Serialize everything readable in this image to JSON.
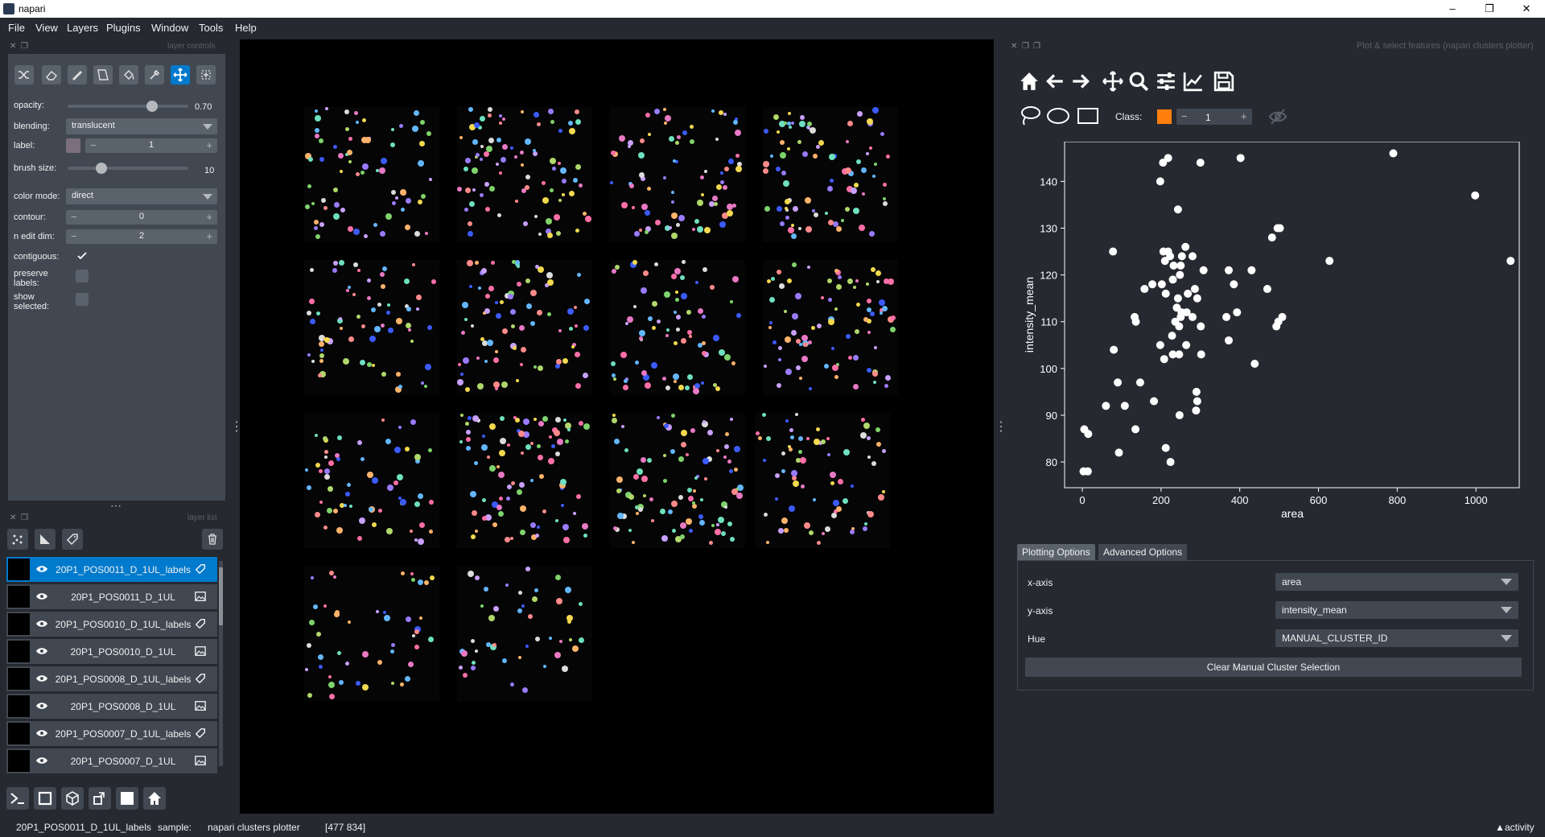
{
  "window": {
    "title": "napari"
  },
  "menu": [
    "File",
    "View",
    "Layers",
    "Plugins",
    "Window",
    "Tools",
    "Help"
  ],
  "layer_controls": {
    "header": "layer controls",
    "opacity_label": "opacity:",
    "opacity_value": "0.70",
    "blending_label": "blending:",
    "blending_value": "translucent",
    "label_label": "label:",
    "label_value": "1",
    "brush_label": "brush size:",
    "brush_value": "10",
    "colormode_label": "color mode:",
    "colormode_value": "direct",
    "contour_label": "contour:",
    "contour_value": "0",
    "ndim_label": "n edit dim:",
    "ndim_value": "2",
    "contiguous_label": "contiguous:",
    "preserve_label": "preserve labels:",
    "show_label": "show selected:",
    "label_color": "#7b6f7f",
    "opacity_fraction": 0.7,
    "brush_fraction": 0.28
  },
  "layer_list": {
    "header": "layer list",
    "layers": [
      {
        "name": "20P1_POS0011_D_1UL_labels",
        "type": "labels",
        "selected": true
      },
      {
        "name": "20P1_POS0011_D_1UL",
        "type": "image",
        "selected": false
      },
      {
        "name": "20P1_POS0010_D_1UL_labels",
        "type": "labels",
        "selected": false
      },
      {
        "name": "20P1_POS0010_D_1UL",
        "type": "image",
        "selected": false
      },
      {
        "name": "20P1_POS0008_D_1UL_labels",
        "type": "labels",
        "selected": false
      },
      {
        "name": "20P1_POS0008_D_1UL",
        "type": "image",
        "selected": false
      },
      {
        "name": "20P1_POS0007_D_1UL_labels",
        "type": "labels",
        "selected": false
      },
      {
        "name": "20P1_POS0007_D_1UL",
        "type": "image",
        "selected": false
      }
    ]
  },
  "plotter": {
    "header": "Plot & select features (napari clusters plotter)",
    "class_label": "Class:",
    "class_value": "1",
    "class_color": "#ff7f0e",
    "tabs": [
      "Plotting Options",
      "Advanced Options"
    ],
    "x_axis_label": "x-axis",
    "x_axis_value": "area",
    "y_axis_label": "y-axis",
    "y_axis_value": "intensity_mean",
    "hue_label": "Hue",
    "hue_value": "MANUAL_CLUSTER_ID",
    "clear_button": "Clear Manual Cluster Selection"
  },
  "chart_data": {
    "type": "scatter",
    "xlabel": "area",
    "ylabel": "intensity_mean",
    "xlim": [
      -45,
      1110
    ],
    "ylim": [
      74.5,
      148.5
    ],
    "xticks": [
      "0",
      "200",
      "400",
      "600",
      "800",
      "1000"
    ],
    "yticks": [
      "80",
      "90",
      "100",
      "110",
      "120",
      "130",
      "140"
    ],
    "point_color": "#ffffff",
    "background": "#262930",
    "points": [
      [
        790,
        146
      ],
      [
        998,
        137
      ],
      [
        1088,
        123
      ],
      [
        628,
        123
      ],
      [
        205,
        144
      ],
      [
        218,
        145
      ],
      [
        300,
        144
      ],
      [
        402,
        145
      ],
      [
        198,
        140
      ],
      [
        243,
        134
      ],
      [
        482,
        128
      ],
      [
        496,
        130
      ],
      [
        502,
        130
      ],
      [
        262,
        126
      ],
      [
        206,
        125
      ],
      [
        218,
        125
      ],
      [
        223,
        124
      ],
      [
        210,
        123
      ],
      [
        232,
        122
      ],
      [
        250,
        122
      ],
      [
        253,
        124
      ],
      [
        280,
        124
      ],
      [
        78,
        125
      ],
      [
        372,
        121
      ],
      [
        430,
        121
      ],
      [
        308,
        121
      ],
      [
        248,
        120
      ],
      [
        230,
        119
      ],
      [
        202,
        118
      ],
      [
        178,
        118
      ],
      [
        158,
        117
      ],
      [
        385,
        118
      ],
      [
        470,
        117
      ],
      [
        212,
        116
      ],
      [
        268,
        116
      ],
      [
        286,
        117
      ],
      [
        292,
        115
      ],
      [
        243,
        115
      ],
      [
        240,
        113
      ],
      [
        252,
        112
      ],
      [
        250,
        111
      ],
      [
        265,
        112
      ],
      [
        280,
        111
      ],
      [
        236,
        110
      ],
      [
        246,
        109
      ],
      [
        133,
        111
      ],
      [
        136,
        110
      ],
      [
        366,
        111
      ],
      [
        393,
        112
      ],
      [
        498,
        110
      ],
      [
        508,
        111
      ],
      [
        493,
        109
      ],
      [
        301,
        109
      ],
      [
        228,
        107
      ],
      [
        372,
        106
      ],
      [
        264,
        105
      ],
      [
        246,
        103
      ],
      [
        230,
        103
      ],
      [
        208,
        102
      ],
      [
        198,
        105
      ],
      [
        302,
        103
      ],
      [
        438,
        101
      ],
      [
        80,
        104
      ],
      [
        90,
        97
      ],
      [
        147,
        97
      ],
      [
        60,
        92
      ],
      [
        108,
        92
      ],
      [
        182,
        93
      ],
      [
        290,
        95
      ],
      [
        292,
        93
      ],
      [
        289,
        91
      ],
      [
        247,
        90
      ],
      [
        135,
        87
      ],
      [
        93,
        82
      ],
      [
        212,
        83
      ],
      [
        224,
        80
      ],
      [
        5,
        87
      ],
      [
        15,
        86
      ],
      [
        3,
        78
      ],
      [
        14,
        78
      ]
    ]
  },
  "statusbar": {
    "layer": "20P1_POS0011_D_1UL_labels",
    "sample": "sample:",
    "plugin": "napari clusters plotter",
    "coords": "[477 834]",
    "activity": "activity"
  }
}
